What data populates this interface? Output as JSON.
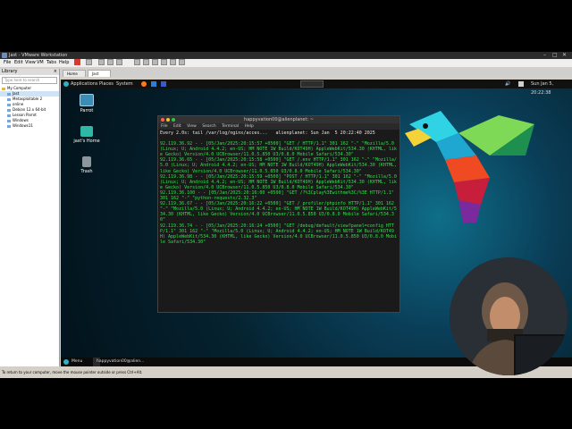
{
  "vmware": {
    "title": "Jast - VMware Workstation",
    "menu": [
      "File",
      "Edit",
      "View",
      "VM",
      "Tabs",
      "Help"
    ],
    "library": {
      "header": "Library",
      "search_placeholder": "Type here to search",
      "root": "My Computer",
      "items": [
        "Jast",
        "Metasploitable 2",
        "online",
        "Debian 12.x 64-bit",
        "Lesson Parrot",
        "Windows",
        "Windows11"
      ]
    },
    "tabs": [
      "Home",
      "Jast"
    ],
    "status_text": "To return to your computer, move the mouse pointer outside or press Ctrl+Alt."
  },
  "guest": {
    "panel": {
      "items": [
        "Applications",
        "Places",
        "System"
      ],
      "datetime": "Sun Jan 5, 20:22:38"
    },
    "desktop_icons": [
      "Parrot",
      "jast's Home",
      "Trash"
    ],
    "terminal": {
      "title": "happyvation00@alienplanet: ~",
      "menu": [
        "File",
        "Edit",
        "View",
        "Search",
        "Terminal",
        "Help"
      ],
      "watch_line": "Every 2.0s: tail /var/log/nginx/acces...   alienplanet: Sun Jan  5 20:22:40 2025",
      "log": [
        "92.119.36.92 - - [05/Jan/2025:20:15:57 +0500] \"GET / HTTP/1.1\" 301 162 \"-\" \"Mozilla/5.0 (Linux; U; Android 4.4.2; en-US; HM NOTE 1W Build/KOT49H) AppleWebKit/534.30 (KHTML, like Gecko) Version/4.0 UCBrowser/11.0.5.850 U3/0.8.0 Mobile Safari/534.30\"",
        "92.119.36.65 - - [05/Jan/2025:20:15:58 +0500] \"GET /.env HTTP/1.1\" 301 162 \"-\" \"Mozilla/5.0 (Linux; U; Android 4.4.2; en-US; HM NOTE 1W Build/KOT49H) AppleWebKit/534.30 (KHTML, like Gecko) Version/4.0 UCBrowser/11.0.5.850 U3/0.8.0 Mobile Safari/534.30\"",
        "92.119.36.98 - - [05/Jan/2025:20:15:59 +0500] \"POST / HTTP/1.1\" 301 162 \"-\" \"Mozilla/5.0 (Linux; U; Android 4.4.2; en-US; HM NOTE 1W Build/KOT49H) AppleWebKit/534.30 (KHTML, like Gecko) Version/4.0 UCBrowser/11.0.5.850 U3/0.8.0 Mobile Safari/534.30\"",
        "92.119.36.100 - - [05/Jan/2025:20:16:00 +0500] \"GET /?%3Cplay%3Ewithme%3C/%3E HTTP/1.1\" 301 162 \"-\" \"python-requests/2.32.3\"",
        "92.119.36.67 - - [05/Jan/2025:20:16:22 +0500] \"GET /_profiler/phpinfo HTTP/1.1\" 301 162 \"-\" \"Mozilla/5.0 (Linux; U; Android 4.4.2; en-US; HM NOTE 1W Build/KOT49H) AppleWebKit/534.30 (KHTML, like Gecko) Version/4.0 UCBrowser/11.0.5.850 U3/0.8.0 Mobile Safari/534.30\"",
        "92.119.36.74 - - [05/Jan/2025:20:16:24 +0500] \"GET /debug/default/view?panel=config HTTP/1.1\" 301 162 \"-\" \"Mozilla/5.0 (Linux; U; Android 4.4.2; en-US; HM NOTE 1W Build/KOT49H) AppleWebKit/534.30 (KHTML, like Gecko) Version/4.0 UCBrowser/11.0.5.850 U3/0.8.0 Mobile Safari/534.30\""
      ]
    },
    "taskbar": {
      "menu": "Menu",
      "task": "happyvation00@alien..."
    }
  },
  "colors": {
    "terminal_text": "#2fe04a",
    "desktop_bg": "#0a3e58"
  }
}
